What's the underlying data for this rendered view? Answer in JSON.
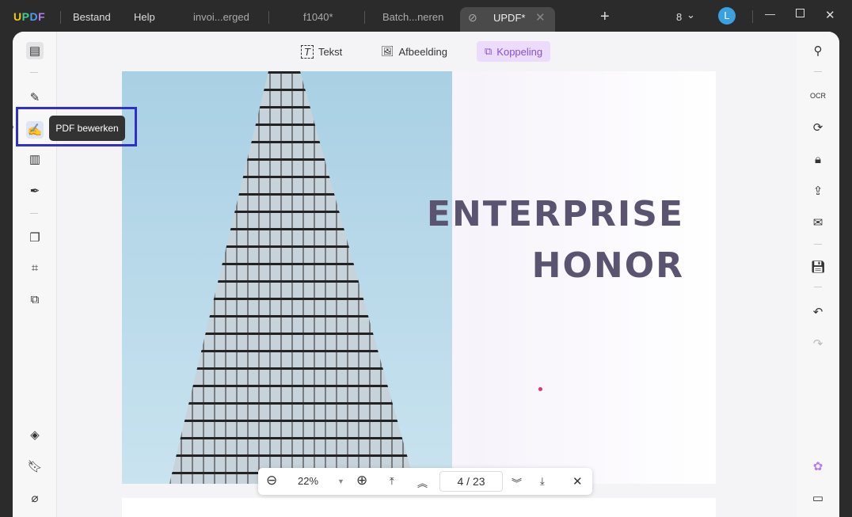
{
  "app": {
    "logo": "UPDF",
    "menu": [
      "Bestand",
      "Help"
    ]
  },
  "tabs": [
    {
      "label": "invoi...erged"
    },
    {
      "label": "f1040*"
    },
    {
      "label": "Batch...neren"
    },
    {
      "label": "UPDF*",
      "active": true
    }
  ],
  "window": {
    "count": "8",
    "avatar": "L"
  },
  "toolbar": {
    "items": [
      "Tekst",
      "Afbeelding",
      "Koppeling"
    ],
    "active": "Koppeling"
  },
  "tooltip": "PDF bewerken",
  "page": {
    "title_line1": "ENTERPRISE",
    "title_line2": "HONOR"
  },
  "nav": {
    "zoom": "22%",
    "current_page": "4",
    "separator": "/",
    "total_pages": "23"
  },
  "colors": {
    "accent": "#b67cf0",
    "highlight": "#3030c8",
    "active_tool_bg": "#ecdcfc"
  }
}
